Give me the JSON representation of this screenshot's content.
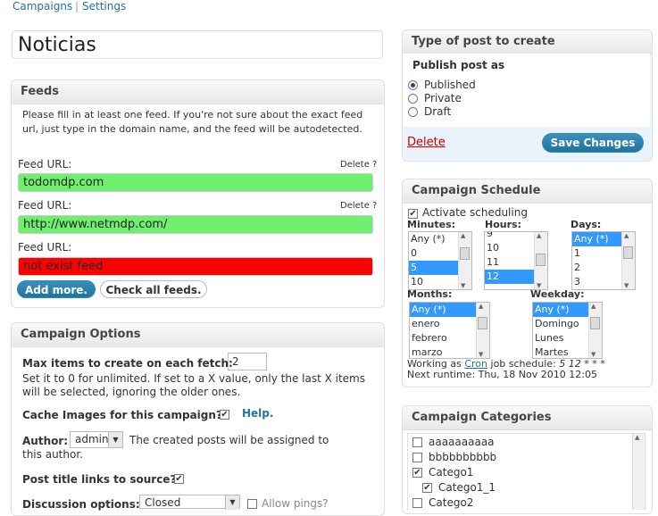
{
  "top_nav": {
    "campaigns": "Campaigns",
    "sep": "|",
    "settings": "Settings"
  },
  "title_value": "Noticias",
  "feeds": {
    "header": "Feeds",
    "help": "Please fill in at least one feed. If you're not sure about the exact feed url, just type in the domain name, and the feed will be autodetected.",
    "items": [
      {
        "label": "Feed URL:",
        "delete": "Delete ?",
        "value": "todomdp.com",
        "status": "ok"
      },
      {
        "label": "Feed URL:",
        "delete": "Delete ?",
        "value": "http://www.netmdp.com/",
        "status": "ok"
      },
      {
        "label": "Feed URL:",
        "delete": "",
        "value": "not exist feed",
        "status": "error"
      }
    ],
    "add_more": "Add more.",
    "check_all": "Check all feeds."
  },
  "options": {
    "header": "Campaign Options",
    "max_items_label": "Max items to create on each fetch:",
    "max_items_value": "2",
    "max_items_help": "Set it to 0 for unlimited. If set to a X value, only the last X items will be selected, ignoring the older ones.",
    "cache_label": "Cache Images for this campaign?",
    "cache_help": "Help.",
    "author_label": "Author:",
    "author_value": "admin",
    "author_help": "The created posts will be assigned to this author.",
    "title_links_label": "Post title links to source?",
    "discussion_label": "Discussion options:",
    "discussion_value": "Closed",
    "allow_pings": "Allow pings?"
  },
  "post_type": {
    "header": "Type of post to create",
    "subheader": "Publish post as",
    "choices": [
      "Published",
      "Private",
      "Draft"
    ],
    "selected": "Published",
    "delete": "Delete",
    "save": "Save Changes"
  },
  "schedule": {
    "header": "Campaign Schedule",
    "activate": "Activate scheduling",
    "minutes_label": "Minutes:",
    "minutes": [
      "Any (*)",
      "0",
      "5",
      "10"
    ],
    "minutes_selected": "5",
    "hours_label": "Hours:",
    "hours": [
      "9",
      "10",
      "11",
      "12"
    ],
    "hours_selected": "12",
    "days_label": "Days:",
    "days": [
      "Any (*)",
      "1",
      "2",
      "3"
    ],
    "days_selected": "Any (*)",
    "months_label": "Months:",
    "months": [
      "Any (*)",
      "enero",
      "febrero",
      "marzo"
    ],
    "months_selected": "Any (*)",
    "weekday_label": "Weekday:",
    "weekdays": [
      "Any (*)",
      "Domingo",
      "Lunes",
      "Martes"
    ],
    "weekday_selected": "Any (*)",
    "working_prefix": "Working as",
    "cron_link": "Cron",
    "working_suffix": "job schedule:",
    "cron_expr": "5 12 * * *",
    "next_runtime": "Next runtime: Thu, 18 Nov 2010 12:05"
  },
  "categories": {
    "header": "Campaign Categories",
    "items": [
      {
        "name": "aaaaaaaaaa",
        "checked": false,
        "indent": 0
      },
      {
        "name": "bbbbbbbbbb",
        "checked": false,
        "indent": 0
      },
      {
        "name": "Catego1",
        "checked": true,
        "indent": 0
      },
      {
        "name": "Catego1_1",
        "checked": true,
        "indent": 1
      },
      {
        "name": "Catego2",
        "checked": false,
        "indent": 0
      }
    ]
  },
  "colors": {
    "link": "#21759b",
    "ok": "#6ef06e",
    "error": "#ff0000",
    "select": "#3399ff",
    "delete": "#cc0000"
  }
}
